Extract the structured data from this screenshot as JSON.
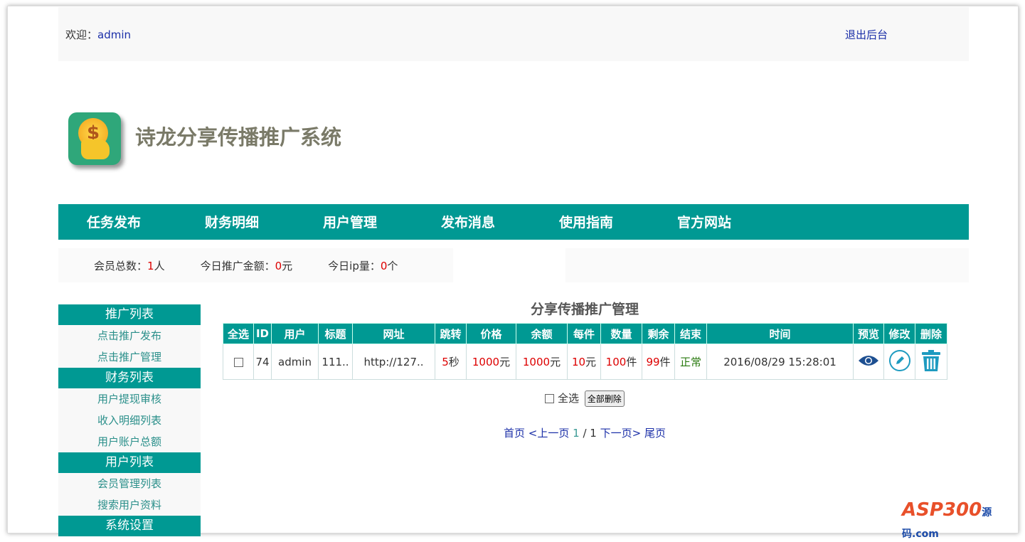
{
  "header": {
    "welcome_label": "欢迎：",
    "username": "admin",
    "logout": "退出后台"
  },
  "site": {
    "title": "诗龙分享传播推广系统",
    "logo_symbol": "$"
  },
  "nav": [
    "任务发布",
    "财务明细",
    "用户管理",
    "发布消息",
    "使用指南",
    "官方网站"
  ],
  "stats": [
    {
      "label": "会员总数：",
      "value": "1",
      "unit": "人"
    },
    {
      "label": "今日推广金额：",
      "value": "0",
      "unit": "元"
    },
    {
      "label": "今日ip量：",
      "value": "0",
      "unit": "个"
    }
  ],
  "sidebar": [
    {
      "title": "推广列表",
      "items": [
        "点击推广发布",
        "点击推广管理"
      ]
    },
    {
      "title": "财务列表",
      "items": [
        "用户提现审核",
        "收入明细列表",
        "用户账户总额"
      ]
    },
    {
      "title": "用户列表",
      "items": [
        "会员管理列表",
        "搜索用户资料"
      ]
    },
    {
      "title": "系统设置",
      "items": []
    }
  ],
  "main": {
    "title": "分享传播推广管理",
    "columns": [
      "全选",
      "ID",
      "用户",
      "标题",
      "网址",
      "跳转",
      "价格",
      "余额",
      "每件",
      "数量",
      "剩余",
      "结束",
      "时间",
      "预览",
      "修改",
      "删除"
    ],
    "rows": [
      {
        "id": "74",
        "user": "admin",
        "title": "111..",
        "url": "http://127..",
        "jump": "5",
        "jump_unit": "秒",
        "price": "1000",
        "price_unit": "元",
        "balance": "1000",
        "balance_unit": "元",
        "each": "10",
        "each_unit": "元",
        "qty": "100",
        "qty_unit": "件",
        "remain": "99",
        "remain_unit": "件",
        "status": "正常",
        "time": "2016/08/29 15:28:01"
      }
    ],
    "select_all": "全选",
    "delete_all": "全部删除"
  },
  "pager": {
    "first": "首页",
    "prev": "<上一页",
    "current": "1",
    "sep": " / ",
    "total": "1",
    "next": "下一页>",
    "last": "尾页"
  },
  "watermark": {
    "brand": "ASP300",
    "sub": "源码",
    "domain": ".com"
  }
}
